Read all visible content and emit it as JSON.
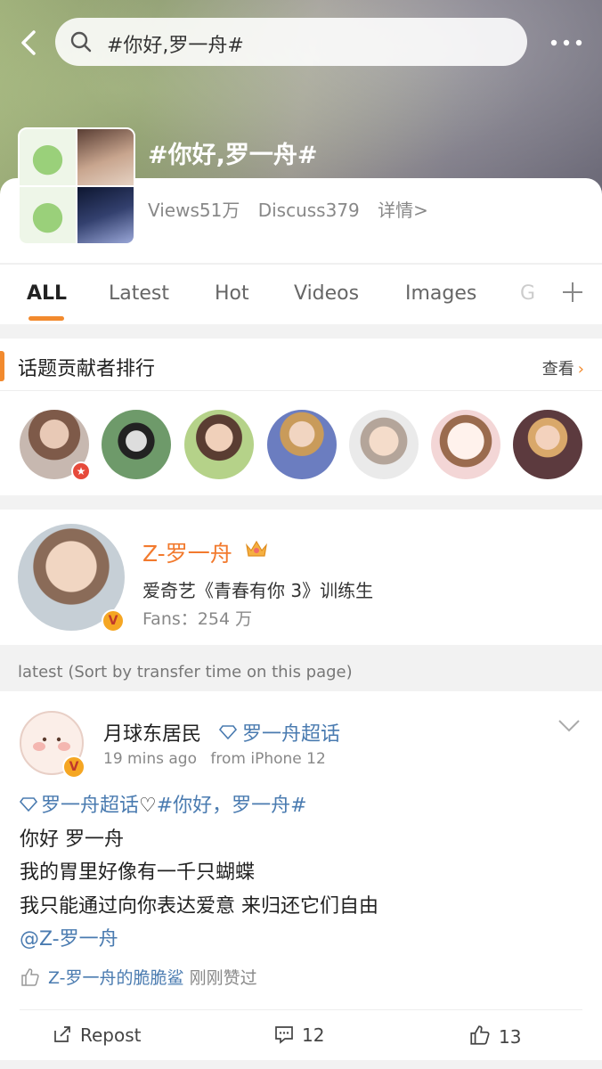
{
  "search": {
    "query": "#你好,罗一舟#"
  },
  "topic": {
    "title": "#你好,罗一舟#",
    "views": "Views51万",
    "discuss": "Discuss379",
    "details": "详情>"
  },
  "tabs": [
    "ALL",
    "Latest",
    "Hot",
    "Videos",
    "Images",
    "G"
  ],
  "contributors": {
    "title": "话题贡献者排行",
    "view_label": "查看",
    "avatars": [
      "avatar-1",
      "avatar-2",
      "avatar-3",
      "avatar-4",
      "avatar-5",
      "avatar-6",
      "avatar-7"
    ]
  },
  "profile": {
    "name": "Z-罗一舟",
    "description": "爱奇艺《青春有你 3》训练生",
    "fans": "Fans：254 万",
    "badge": "V"
  },
  "latest_label": "latest (Sort by transfer time on this page)",
  "post": {
    "author": "月球东居民",
    "supertopic": "罗一舟超话",
    "time": "19 mins ago",
    "device": "from iPhone 12",
    "line1_supertopic": "罗一舟超话",
    "line1_heart": "♡",
    "line1_hashtag": "#你好，罗一舟#",
    "line2": "你好 罗一舟",
    "line3": "我的胃里好像有一千只蝴蝶",
    "line4": "我只能通过向你表达爱意 来归还它们自由",
    "mention": "@Z-罗一舟",
    "liker": "Z-罗一舟的脆脆鲨",
    "liked_text": "刚刚赞过",
    "repost_label": "Repost",
    "comments": "12",
    "likes": "13"
  },
  "colors": {
    "accent": "#f28a2e",
    "link": "#4a7bb0",
    "badge_red": "#e64a3b"
  }
}
